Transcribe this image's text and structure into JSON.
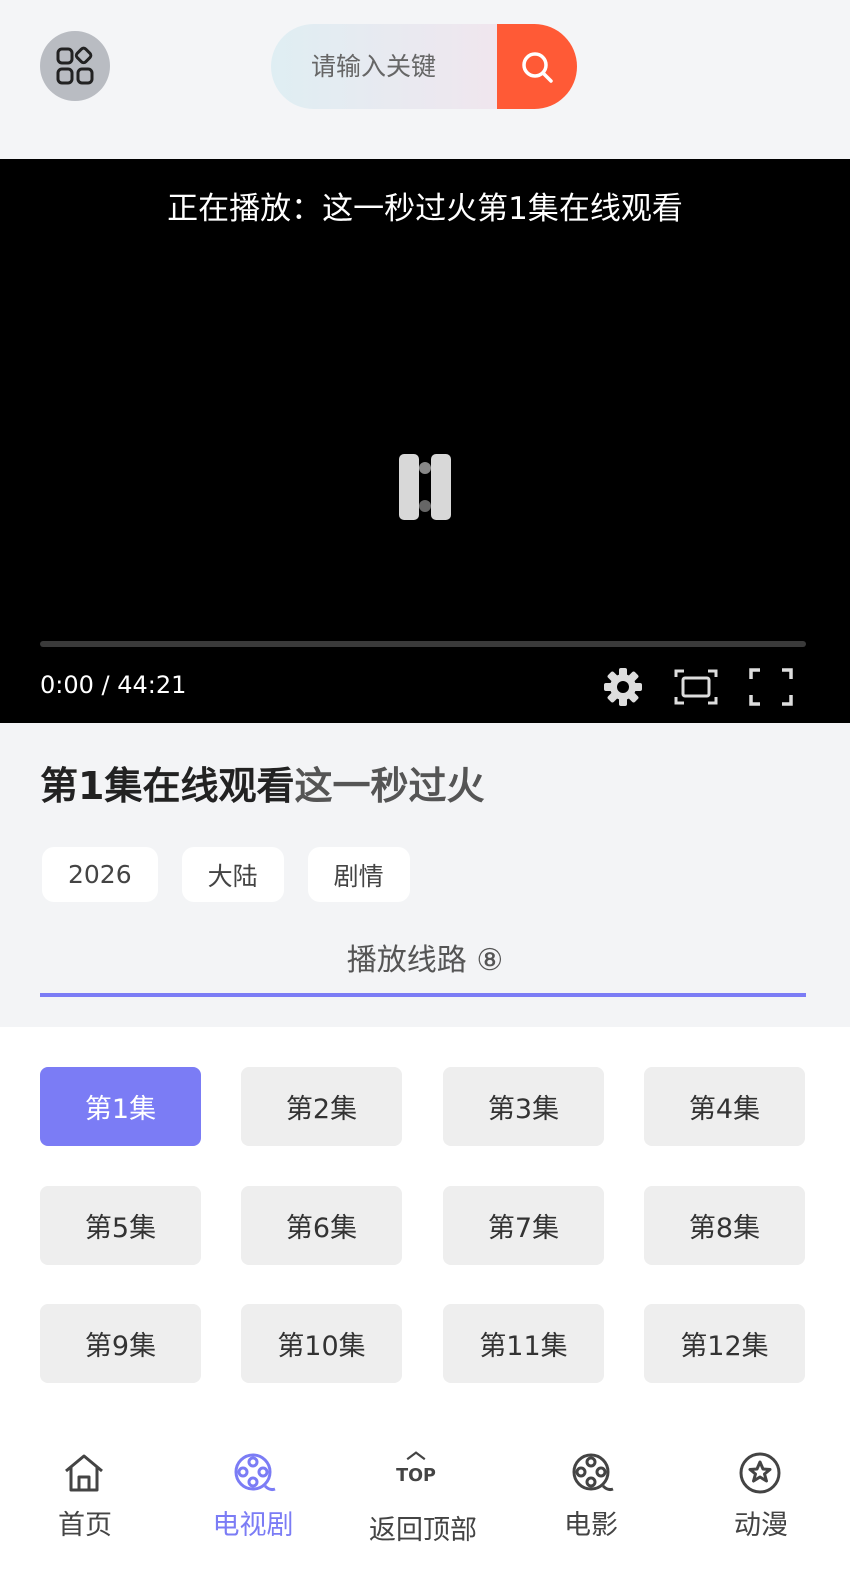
{
  "header": {
    "search_placeholder": "请输入关键"
  },
  "player": {
    "now_playing": "正在播放：这一秒过火第1集在线观看",
    "time": "0:00 / 44:21",
    "progress": 0
  },
  "info": {
    "title_episode": "第1集在线观看",
    "title_series": "这一秒过火",
    "tags": [
      "2026",
      "大陆",
      "剧情"
    ],
    "route_label": "播放线路 ⑧"
  },
  "episodes": [
    "第1集",
    "第2集",
    "第3集",
    "第4集",
    "第5集",
    "第6集",
    "第7集",
    "第8集",
    "第9集",
    "第10集",
    "第11集",
    "第12集"
  ],
  "nav": {
    "items": [
      {
        "label": "首页",
        "icon": "home-icon"
      },
      {
        "label": "电视剧",
        "icon": "tv-reel-icon"
      },
      {
        "label": "返回顶部",
        "icon": "top-icon"
      },
      {
        "label": "电影",
        "icon": "film-reel-icon"
      },
      {
        "label": "动漫",
        "icon": "star-icon"
      }
    ],
    "top_text": "TOP"
  },
  "colors": {
    "accent": "#7b7cf5",
    "search_button": "#ff5a36"
  }
}
